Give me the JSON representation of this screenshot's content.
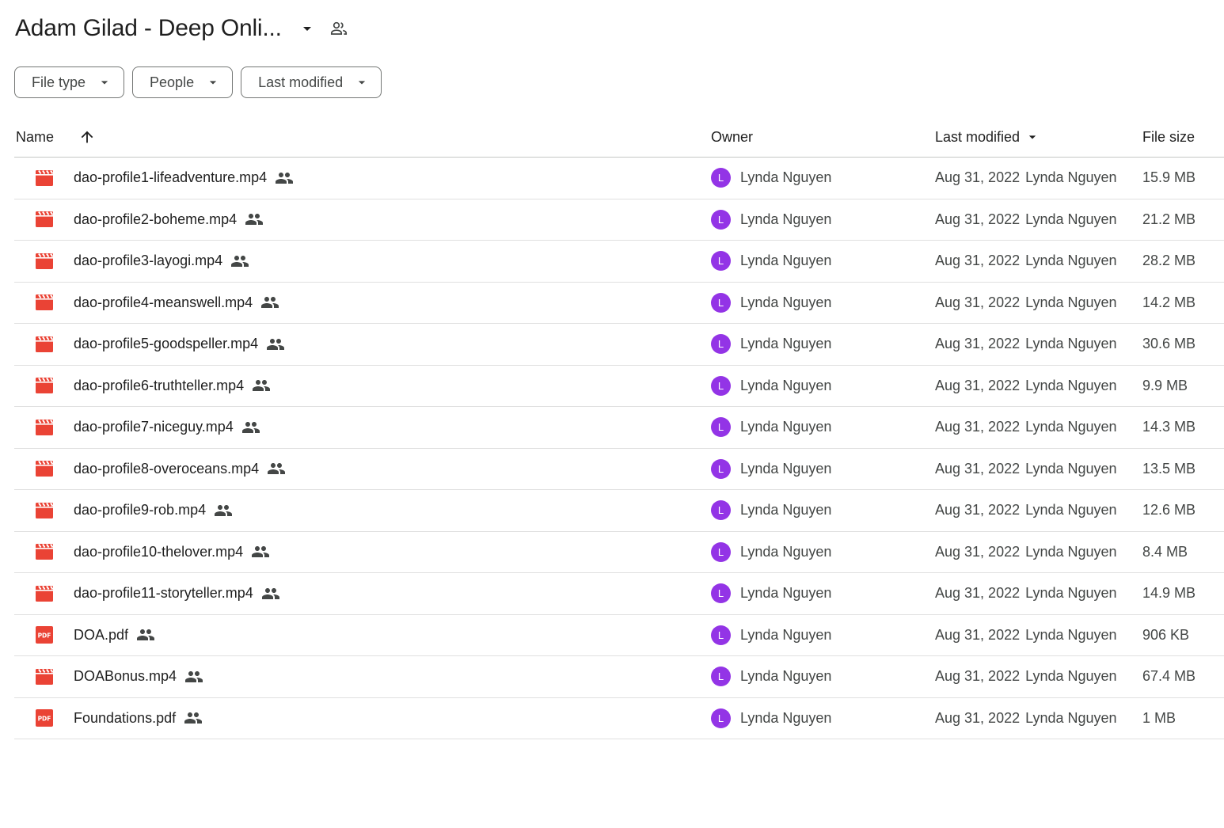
{
  "header": {
    "title": "Adam Gilad - Deep Onli...",
    "title_caret_icon": "arrow-drop-down-icon",
    "share_icon": "people-outline-icon"
  },
  "filters": [
    {
      "label": "File type",
      "icon": "arrow-drop-down-icon"
    },
    {
      "label": "People",
      "icon": "arrow-drop-down-icon"
    },
    {
      "label": "Last modified",
      "icon": "arrow-drop-down-icon"
    }
  ],
  "columns": {
    "name": "Name",
    "owner": "Owner",
    "last_modified": "Last modified",
    "file_size": "File size",
    "name_sort_icon": "arrow-upward-icon",
    "modified_sort_icon": "arrow-drop-down-icon"
  },
  "colors": {
    "video_icon": "#ea4335",
    "pdf_icon": "#ea4335",
    "avatar": "#9334e6"
  },
  "files": [
    {
      "name": "dao-profile1-lifeadventure.mp4",
      "type": "video",
      "owner": "Lynda Nguyen",
      "owner_initial": "L",
      "modified": "Aug 31, 2022",
      "modified_by": "Lynda Nguyen",
      "size": "15.9 MB"
    },
    {
      "name": "dao-profile2-boheme.mp4",
      "type": "video",
      "owner": "Lynda Nguyen",
      "owner_initial": "L",
      "modified": "Aug 31, 2022",
      "modified_by": "Lynda Nguyen",
      "size": "21.2 MB"
    },
    {
      "name": "dao-profile3-layogi.mp4",
      "type": "video",
      "owner": "Lynda Nguyen",
      "owner_initial": "L",
      "modified": "Aug 31, 2022",
      "modified_by": "Lynda Nguyen",
      "size": "28.2 MB"
    },
    {
      "name": "dao-profile4-meanswell.mp4",
      "type": "video",
      "owner": "Lynda Nguyen",
      "owner_initial": "L",
      "modified": "Aug 31, 2022",
      "modified_by": "Lynda Nguyen",
      "size": "14.2 MB"
    },
    {
      "name": "dao-profile5-goodspeller.mp4",
      "type": "video",
      "owner": "Lynda Nguyen",
      "owner_initial": "L",
      "modified": "Aug 31, 2022",
      "modified_by": "Lynda Nguyen",
      "size": "30.6 MB"
    },
    {
      "name": "dao-profile6-truthteller.mp4",
      "type": "video",
      "owner": "Lynda Nguyen",
      "owner_initial": "L",
      "modified": "Aug 31, 2022",
      "modified_by": "Lynda Nguyen",
      "size": "9.9 MB"
    },
    {
      "name": "dao-profile7-niceguy.mp4",
      "type": "video",
      "owner": "Lynda Nguyen",
      "owner_initial": "L",
      "modified": "Aug 31, 2022",
      "modified_by": "Lynda Nguyen",
      "size": "14.3 MB"
    },
    {
      "name": "dao-profile8-overoceans.mp4",
      "type": "video",
      "owner": "Lynda Nguyen",
      "owner_initial": "L",
      "modified": "Aug 31, 2022",
      "modified_by": "Lynda Nguyen",
      "size": "13.5 MB"
    },
    {
      "name": "dao-profile9-rob.mp4",
      "type": "video",
      "owner": "Lynda Nguyen",
      "owner_initial": "L",
      "modified": "Aug 31, 2022",
      "modified_by": "Lynda Nguyen",
      "size": "12.6 MB"
    },
    {
      "name": "dao-profile10-thelover.mp4",
      "type": "video",
      "owner": "Lynda Nguyen",
      "owner_initial": "L",
      "modified": "Aug 31, 2022",
      "modified_by": "Lynda Nguyen",
      "size": "8.4 MB"
    },
    {
      "name": "dao-profile11-storyteller.mp4",
      "type": "video",
      "owner": "Lynda Nguyen",
      "owner_initial": "L",
      "modified": "Aug 31, 2022",
      "modified_by": "Lynda Nguyen",
      "size": "14.9 MB"
    },
    {
      "name": "DOA.pdf",
      "type": "pdf",
      "owner": "Lynda Nguyen",
      "owner_initial": "L",
      "modified": "Aug 31, 2022",
      "modified_by": "Lynda Nguyen",
      "size": "906 KB"
    },
    {
      "name": "DOABonus.mp4",
      "type": "video",
      "owner": "Lynda Nguyen",
      "owner_initial": "L",
      "modified": "Aug 31, 2022",
      "modified_by": "Lynda Nguyen",
      "size": "67.4 MB"
    },
    {
      "name": "Foundations.pdf",
      "type": "pdf",
      "owner": "Lynda Nguyen",
      "owner_initial": "L",
      "modified": "Aug 31, 2022",
      "modified_by": "Lynda Nguyen",
      "size": "1 MB"
    }
  ]
}
